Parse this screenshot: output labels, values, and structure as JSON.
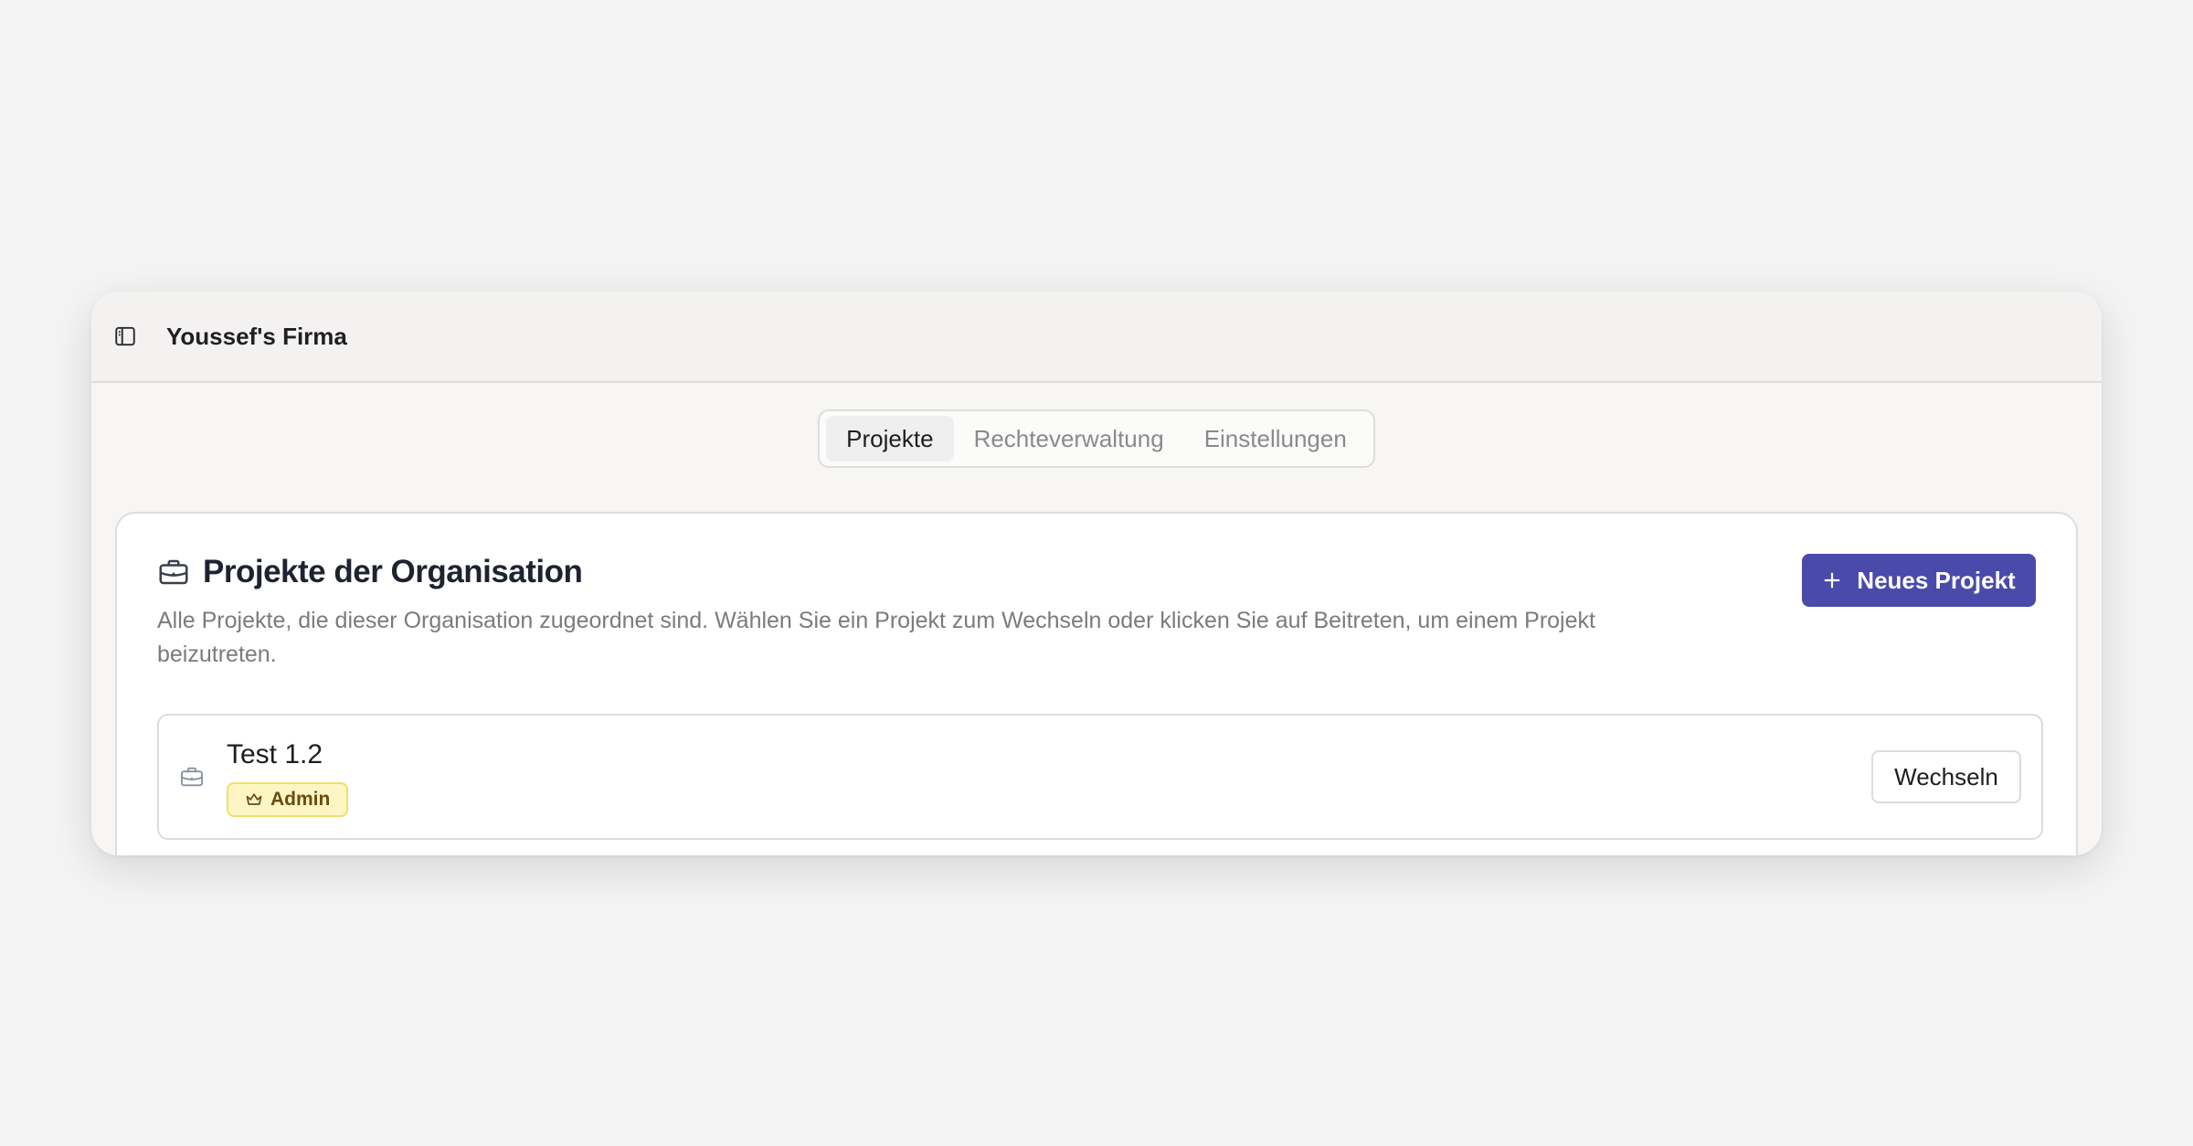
{
  "header": {
    "org_name": "Youssef's Firma"
  },
  "tabs": [
    {
      "label": "Projekte",
      "active": true
    },
    {
      "label": "Rechteverwaltung",
      "active": false
    },
    {
      "label": "Einstellungen",
      "active": false
    }
  ],
  "projects_card": {
    "title": "Projekte der Organisation",
    "description": "Alle Projekte, die dieser Organisation zugeordnet sind. Wählen Sie ein Projekt zum Wechseln oder klicken Sie auf Beitreten, um einem Projekt beizutreten.",
    "new_project_label": "Neues Projekt",
    "projects": [
      {
        "name": "Test 1.2",
        "role": "Admin",
        "action_label": "Wechseln"
      }
    ]
  },
  "icons": {
    "sidebar_toggle": "sidebar-toggle-icon",
    "briefcase": "briefcase-icon",
    "plus": "plus-icon",
    "crown": "crown-icon"
  },
  "colors": {
    "primary_button": "#4a4aab",
    "admin_badge_bg": "#fdf6c4",
    "admin_badge_border": "#f0df6a",
    "admin_badge_text": "#6b4a10"
  }
}
